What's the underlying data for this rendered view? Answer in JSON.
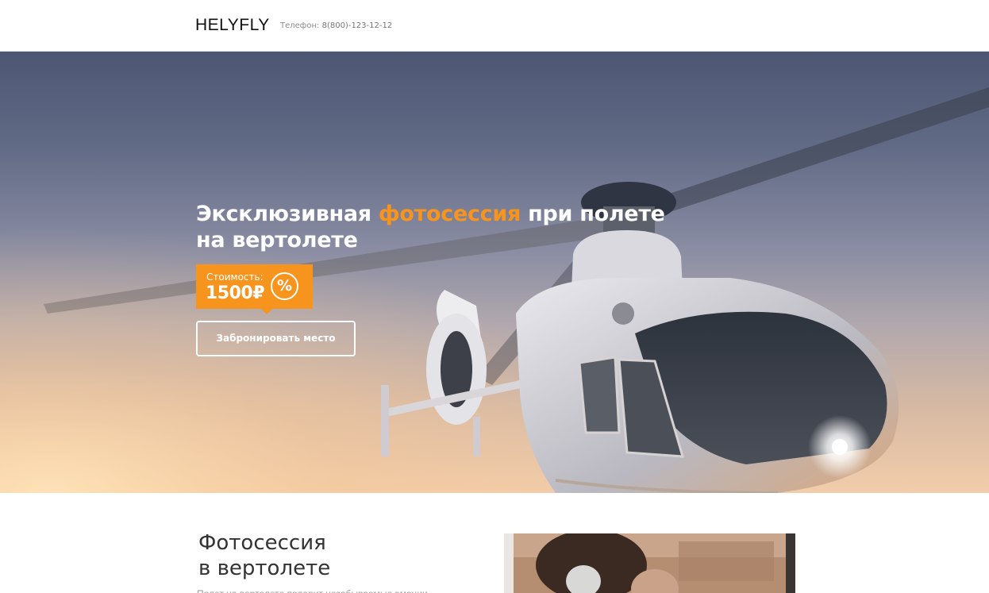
{
  "header": {
    "logo": "HELYFLY",
    "phone_label": "Телефон:",
    "phone_number": "8(800)-123-12-12"
  },
  "hero": {
    "title_part1": "Эксклюзивная ",
    "title_accent": "фотосессия",
    "title_part2": " при полете",
    "title_line2": "на вертолете",
    "price_label": "Стоимость:",
    "price_value": "1500₽",
    "discount_symbol": "%",
    "book_button": "Забронировать место",
    "accent_color": "#f7941d"
  },
  "section": {
    "title_line1": "Фотосессия",
    "title_line2": "в вертолете",
    "text": "Полет на вертолете подарит незабываемые эмоции"
  },
  "icons": {
    "helicopter": "helicopter-image",
    "discount": "percent-icon"
  }
}
